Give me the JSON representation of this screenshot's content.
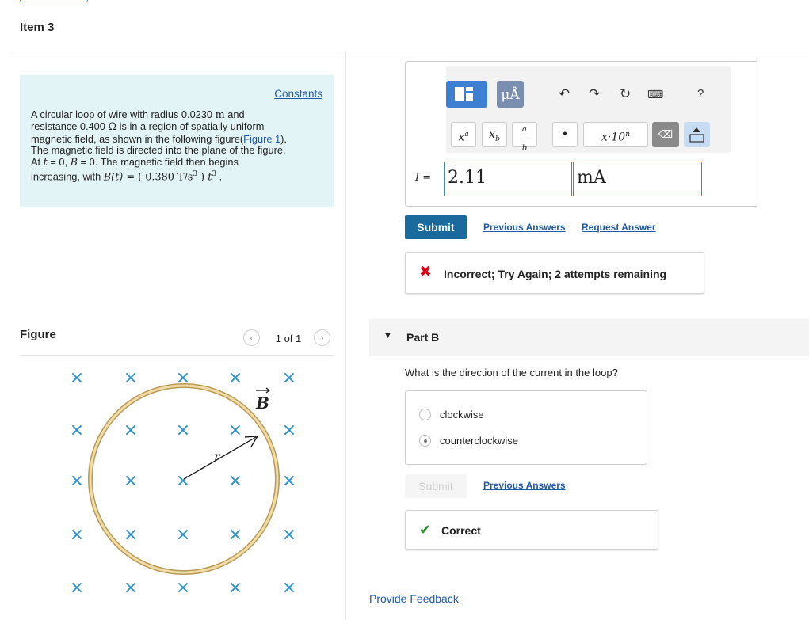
{
  "item": {
    "title": "Item 3"
  },
  "statement": {
    "constants_link": "Constants",
    "line1_pre": "A circular loop of wire with radius 0.0230 ",
    "unit_m": "m",
    "line1_post": " and",
    "line2_pre": "resistance 0.400 ",
    "unit_ohm": "Ω",
    "line2_post": " is in a region of spatially uniform",
    "line3_pre": "magnetic field, as shown in the following figure(",
    "figure_link": "Figure 1",
    "line3_post": ").",
    "line4": "The magnetic field is directed into the plane of the figure.",
    "line5_a": "At ",
    "var_t": "t",
    "line5_b": " = 0, ",
    "var_B": "B",
    "line5_c": " = 0. The magnetic field then begins",
    "line6_pre": "increasing, with ",
    "func": "B(t)",
    "eq": " = ( 0.380 ",
    "unit_Ts3": "T/s",
    "exp3": "3",
    "eq_close": " ) ",
    "period": " ."
  },
  "figure": {
    "title": "Figure",
    "prev_icon": "chevron-left-icon",
    "next_icon": "chevron-right-icon",
    "counter": "1 of 1",
    "field_label": "B",
    "radius_label": "r",
    "cross_symbol": "×",
    "cross_color": "#2a8fd1",
    "loop_color": "#d9b56a"
  },
  "part_a": {
    "toolbar": {
      "templates_icon": "templates-icon",
      "units_label": "μÅ",
      "undo_icon": "undo-icon",
      "redo_icon": "redo-icon",
      "reset_icon": "reset-icon",
      "keyboard_icon": "keyboard-icon",
      "help_label": "?",
      "superscript_label": "x",
      "superscript_sup": "a",
      "subscript_label": "x",
      "subscript_sub": "b",
      "fraction_num": "a",
      "fraction_den": "b",
      "dot_label": "•",
      "sci_label": "x·10",
      "sci_sup": "n",
      "delete_icon": "delete-icon",
      "keyboard_toggle_icon": "keyboard-toggle-icon"
    },
    "variable": "I",
    "equals": " =",
    "value": "2.11",
    "unit": "mA",
    "submit_label": "Submit",
    "previous_answers": "Previous Answers",
    "request_answer": "Request Answer",
    "feedback_icon": "x-mark-icon",
    "feedback_text": "Incorrect; Try Again; 2 attempts remaining",
    "feedback_color": "#d6001c"
  },
  "part_b": {
    "title": "Part B",
    "question": "What is the direction of the current in the loop?",
    "options": [
      {
        "label": "clockwise",
        "selected": false
      },
      {
        "label": "counterclockwise",
        "selected": true
      }
    ],
    "submit_label": "Submit",
    "previous_answers": "Previous Answers",
    "feedback_icon": "check-icon",
    "feedback_text": "Correct",
    "feedback_color": "#2e8b2e"
  },
  "footer": {
    "provide_feedback": "Provide Feedback"
  }
}
